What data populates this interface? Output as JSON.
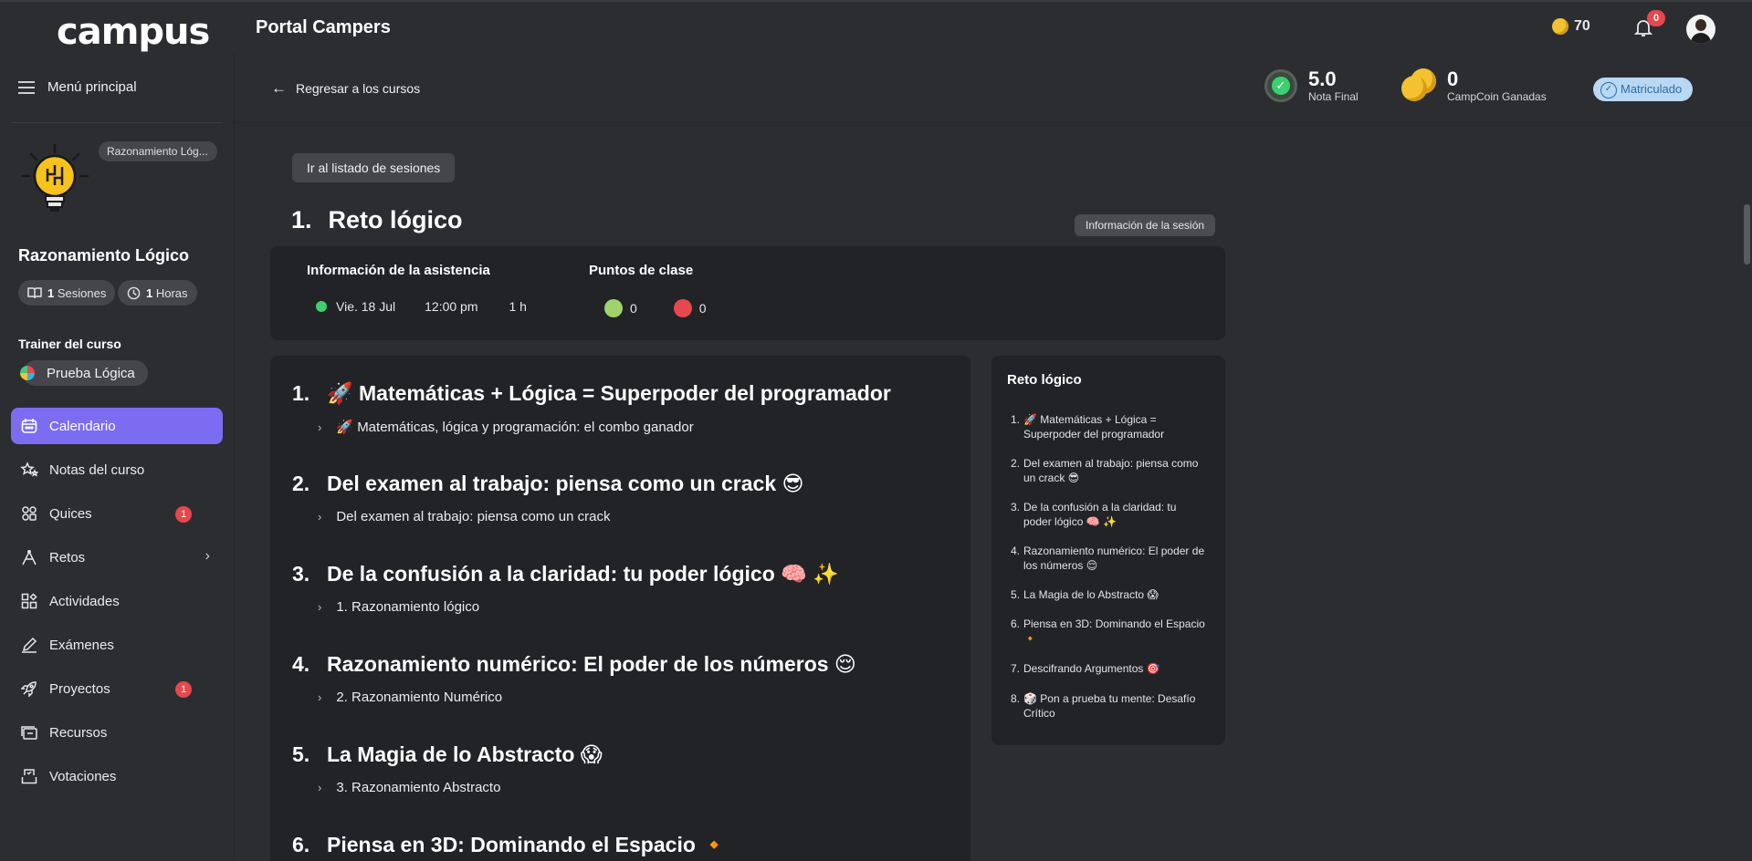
{
  "app": {
    "logo": "campus",
    "title": "Portal Campers",
    "coins": "70",
    "notifications": "0"
  },
  "sidebar": {
    "menu_label": "Menú principal",
    "course_chip": "Razonamiento Lóg...",
    "course_name": "Razonamiento Lógico",
    "sessions_count": "1",
    "sessions_label": "Sesiones",
    "hours_count": "1",
    "hours_label": "Horas",
    "trainer_label": "Trainer del curso",
    "trainer_name": "Prueba Lógica",
    "items": [
      {
        "label": "Calendario",
        "icon": "calendar-icon",
        "active": true
      },
      {
        "label": "Notas del curso",
        "icon": "stars-icon"
      },
      {
        "label": "Quices",
        "icon": "quiz-icon",
        "badge": "1"
      },
      {
        "label": "Retos",
        "icon": "challenge-icon",
        "chevron": true
      },
      {
        "label": "Actividades",
        "icon": "activities-icon"
      },
      {
        "label": "Exámenes",
        "icon": "exam-icon"
      },
      {
        "label": "Proyectos",
        "icon": "rocket-icon",
        "badge": "1"
      },
      {
        "label": "Recursos",
        "icon": "resources-icon"
      },
      {
        "label": "Votaciones",
        "icon": "vote-icon"
      }
    ]
  },
  "header": {
    "back_label": "Regresar a los cursos",
    "grade_value": "5.0",
    "grade_label": "Nota Final",
    "campcoin_value": "0",
    "campcoin_label": "CampCoin Ganadas",
    "status": "Matriculado"
  },
  "session": {
    "list_button": "Ir al listado de sesiones",
    "number": "1.",
    "title": "Reto lógico",
    "info_button": "Información de la sesión",
    "attendance_title": "Información de la asistencia",
    "date": "Vie. 18 Jul",
    "time": "12:00 pm",
    "duration": "1 h",
    "points_title": "Puntos de clase",
    "positive_points": "0",
    "negative_points": "0"
  },
  "topics": [
    {
      "num": "1.",
      "title": "🚀 Matemáticas + Lógica = Superpoder del programador",
      "sub": "🚀 Matemáticas, lógica y programación: el combo ganador"
    },
    {
      "num": "2.",
      "title": "Del examen al trabajo: piensa como un crack 😎",
      "sub": "Del examen al trabajo: piensa como un crack"
    },
    {
      "num": "3.",
      "title": "De la confusión a la claridad: tu poder lógico 🧠 ✨",
      "sub": "1. Razonamiento lógico"
    },
    {
      "num": "4.",
      "title": "Razonamiento numérico: El poder de los números 😌",
      "sub": "2. Razonamiento Numérico"
    },
    {
      "num": "5.",
      "title": "La Magia de lo Abstracto 😱",
      "sub": "3. Razonamiento Abstracto"
    },
    {
      "num": "6.",
      "title": "Piensa en 3D: Dominando el Espacio 🔸",
      "sub": ""
    }
  ],
  "toc": {
    "title": "Reto lógico",
    "items": [
      {
        "num": "1.",
        "text": "🚀 Matemáticas + Lógica = Superpoder del programador"
      },
      {
        "num": "2.",
        "text": "Del examen al trabajo: piensa como un crack 😎"
      },
      {
        "num": "3.",
        "text": "De la confusión a la claridad: tu poder lógico 🧠 ✨"
      },
      {
        "num": "4.",
        "text": "Razonamiento numérico: El poder de los números 😌"
      },
      {
        "num": "5.",
        "text": "La Magia de lo Abstracto 😱"
      },
      {
        "num": "6.",
        "text": "Piensa en 3D: Dominando el Espacio 🔸"
      },
      {
        "num": "7.",
        "text": "Descifrando Argumentos 🎯"
      },
      {
        "num": "8.",
        "text": "🎲 Pon a prueba tu mente: Desafío Crítico"
      }
    ]
  },
  "colors": {
    "accent": "#7c6cf2",
    "background": "#2c2d31",
    "card": "#222327",
    "badge": "#e5484d",
    "success": "#3ccf6e"
  }
}
